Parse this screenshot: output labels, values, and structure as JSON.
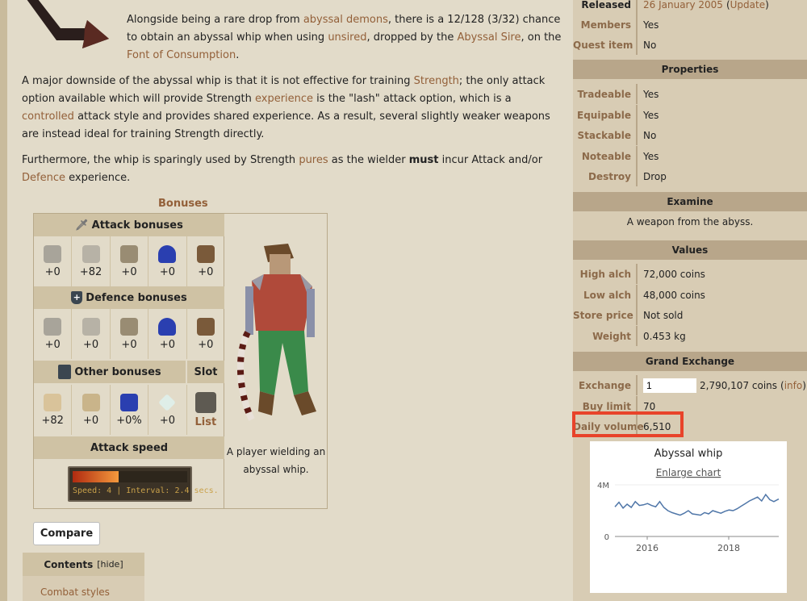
{
  "article": {
    "p1": {
      "t1": "Alongside being a rare drop from ",
      "l1": "abyssal demons",
      "t2": ", there is a 12/128 (3/32) chance to obtain an abyssal whip when using ",
      "l2": "unsired",
      "t3": ", dropped by the ",
      "l3": "Abyssal Sire",
      "t4": ", on the ",
      "l4": "Font of Consumption",
      "t5": "."
    },
    "p2": {
      "t1": "A major downside of the abyssal whip is that it is not effective for training ",
      "l1": "Strength",
      "t2": "; the only attack option available which will provide Strength ",
      "l2": "experience",
      "t3": " is the \"lash\" attack option, which is a ",
      "l3": "controlled",
      "t4": " attack style and provides shared experience. As a result, several slightly weaker weapons are instead ideal for training Strength directly."
    },
    "p3": {
      "t1": "Furthermore, the whip is sparingly used by Strength ",
      "l1": "pures",
      "t2": " as the wielder ",
      "b1": "must",
      "t3": " incur Attack and/or ",
      "l2": "Defence",
      "t4": " experience."
    }
  },
  "bonuses": {
    "title": "Bonuses",
    "attack_header": "Attack bonuses",
    "attack": [
      "+0",
      "+82",
      "+0",
      "+0",
      "+0"
    ],
    "defence_header": "Defence bonuses",
    "defence": [
      "+0",
      "+0",
      "+0",
      "+0",
      "+0"
    ],
    "other_header": "Other bonuses",
    "slot_header": "Slot",
    "other": [
      "+82",
      "+0",
      "+0%",
      "+0"
    ],
    "slot_link": "List",
    "speed_header": "Attack speed",
    "speed_label": "Speed: 4",
    "interval_label": "Interval: 2.4 secs.",
    "speed_fraction": 0.4,
    "caption": "A player wielding an abyssal whip."
  },
  "compare_button": "Compare",
  "toc": {
    "title": "Contents",
    "hide": "[hide]",
    "items": [
      "Combat styles"
    ]
  },
  "infobox": {
    "released_label": "Released",
    "released_value": "26 January 2005",
    "update_link": "Update",
    "members_label": "Members",
    "members_value": "Yes",
    "quest_label": "Quest item",
    "quest_value": "No",
    "properties_header": "Properties",
    "properties": [
      {
        "label": "Tradeable",
        "value": "Yes"
      },
      {
        "label": "Equipable",
        "value": "Yes"
      },
      {
        "label": "Stackable",
        "value": "No"
      },
      {
        "label": "Noteable",
        "value": "Yes"
      },
      {
        "label": "Destroy",
        "value": "Drop"
      }
    ],
    "examine_header": "Examine",
    "examine_text": "A weapon from the abyss.",
    "values_header": "Values",
    "values": [
      {
        "label": "High alch",
        "value": "72,000 coins"
      },
      {
        "label": "Low alch",
        "value": "48,000 coins"
      },
      {
        "label": "Store price",
        "value": "Not sold"
      },
      {
        "label": "Weight",
        "value": "0.453 kg"
      }
    ],
    "ge_header": "Grand Exchange",
    "exchange_label": "Exchange",
    "exchange_qty": "1",
    "exchange_price": "2,790,107 coins",
    "info_link": "info",
    "buy_limit_label": "Buy limit",
    "buy_limit_value": "70",
    "daily_volume_label": "Daily volume",
    "daily_volume_value": "6,510",
    "highlight_color": "#e8432a"
  },
  "chart_data": {
    "type": "line",
    "title": "Abyssal whip",
    "link": "Enlarge chart",
    "ytick_labels": [
      "0",
      "4M"
    ],
    "xtick_labels": [
      "2016",
      "2018"
    ],
    "ylim": [
      0,
      4000000
    ],
    "xlim": [
      2015.2,
      2019.22
    ],
    "line_color": "#4f76a8",
    "x": [
      2015.2,
      2015.3,
      2015.4,
      2015.5,
      2015.6,
      2015.7,
      2015.8,
      2015.9,
      2016.0,
      2016.1,
      2016.2,
      2016.3,
      2016.4,
      2016.5,
      2016.6,
      2016.7,
      2016.8,
      2016.9,
      2017.0,
      2017.1,
      2017.2,
      2017.3,
      2017.4,
      2017.5,
      2017.6,
      2017.7,
      2017.8,
      2017.9,
      2018.0,
      2018.1,
      2018.2,
      2018.3,
      2018.4,
      2018.5,
      2018.6,
      2018.7,
      2018.8,
      2018.9,
      2019.0,
      2019.1,
      2019.22
    ],
    "y": [
      2300000,
      2650000,
      2200000,
      2500000,
      2250000,
      2700000,
      2400000,
      2450000,
      2550000,
      2400000,
      2300000,
      2700000,
      2250000,
      2000000,
      1850000,
      1750000,
      1650000,
      1800000,
      2000000,
      1750000,
      1700000,
      1650000,
      1850000,
      1750000,
      2000000,
      1900000,
      1800000,
      1950000,
      2050000,
      2000000,
      2150000,
      2350000,
      2550000,
      2750000,
      2900000,
      3050000,
      2750000,
      3250000,
      2850000,
      2700000,
      2900000
    ]
  }
}
